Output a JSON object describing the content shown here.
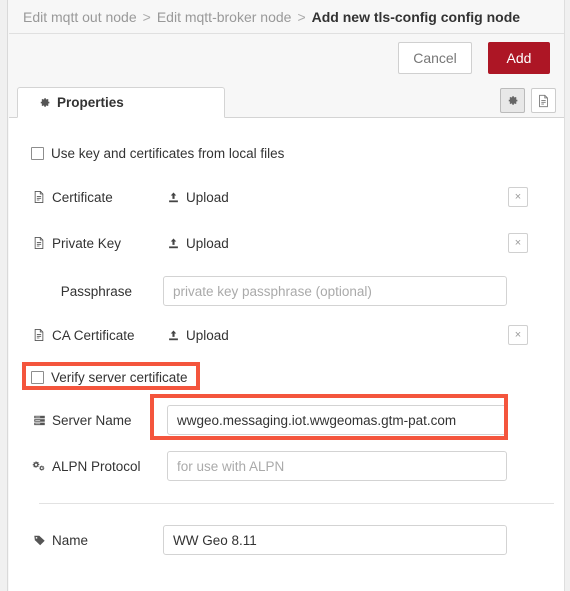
{
  "breadcrumb": {
    "items": [
      {
        "label": "Edit mqtt out node",
        "current": false
      },
      {
        "label": "Edit mqtt-broker node",
        "current": false
      },
      {
        "label": "Add new tls-config config node",
        "current": true
      }
    ],
    "separator": ">"
  },
  "actions": {
    "cancel_label": "Cancel",
    "add_label": "Add",
    "add_color": "#ad1625"
  },
  "tabs": {
    "properties_label": "Properties",
    "gear_icon": "gear-icon",
    "description_icon": "document-icon"
  },
  "form": {
    "use_local_files": {
      "label": "Use key and certificates from local files",
      "checked": false
    },
    "certificate": {
      "label": "Certificate",
      "icon": "file-icon",
      "upload_label": "Upload",
      "upload_icon": "upload-icon",
      "delete_label": "×"
    },
    "private_key": {
      "label": "Private Key",
      "icon": "file-icon",
      "upload_label": "Upload",
      "upload_icon": "upload-icon",
      "delete_label": "×"
    },
    "passphrase": {
      "label": "Passphrase",
      "placeholder": "private key passphrase (optional)",
      "value": ""
    },
    "ca_certificate": {
      "label": "CA Certificate",
      "icon": "file-icon",
      "upload_label": "Upload",
      "upload_icon": "upload-icon",
      "delete_label": "×"
    },
    "verify_server_certificate": {
      "label": "Verify server certificate",
      "checked": false
    },
    "server_name": {
      "label": "Server Name",
      "icon": "server-icon",
      "value": "wwgeo.messaging.iot.wwgeomas.gtm-pat.com",
      "placeholder": ""
    },
    "alpn_protocol": {
      "label": "ALPN Protocol",
      "icon": "cogs-icon",
      "value": "",
      "placeholder": "for use with ALPN"
    },
    "name": {
      "label": "Name",
      "icon": "tag-icon",
      "value": "WW Geo 8.11",
      "placeholder": ""
    }
  },
  "annotations": {
    "highlight_color": "#f4553d",
    "boxes": [
      {
        "target": "verify-server-certificate-checkbox"
      },
      {
        "target": "server-name-input"
      }
    ]
  }
}
